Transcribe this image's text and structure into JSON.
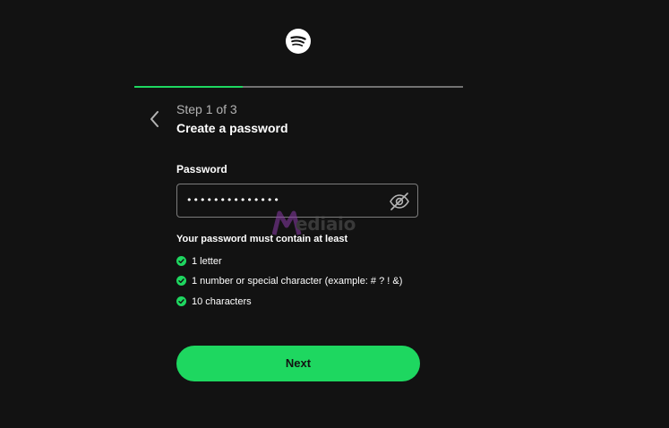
{
  "header": {
    "logo_icon": "spotify-logo-icon"
  },
  "progress": {
    "value_percent": 33,
    "fill_color": "#1ed760",
    "track_color": "#727272"
  },
  "step": {
    "label": "Step 1 of 3",
    "title": "Create a password"
  },
  "password": {
    "label": "Password",
    "value": "••••••••••••••",
    "toggle_icon": "eye-slash-icon"
  },
  "requirements": {
    "heading": "Your password must contain at least",
    "items": [
      {
        "text": "1 letter",
        "met": true
      },
      {
        "text": "1 number or special character (example: # ? ! &)",
        "met": true
      },
      {
        "text": "10 characters",
        "met": true
      }
    ]
  },
  "actions": {
    "next_label": "Next"
  },
  "watermark": {
    "text": "ediaio"
  },
  "colors": {
    "background": "#121212",
    "accent": "#1ed760",
    "muted_text": "#b3b3b3"
  }
}
